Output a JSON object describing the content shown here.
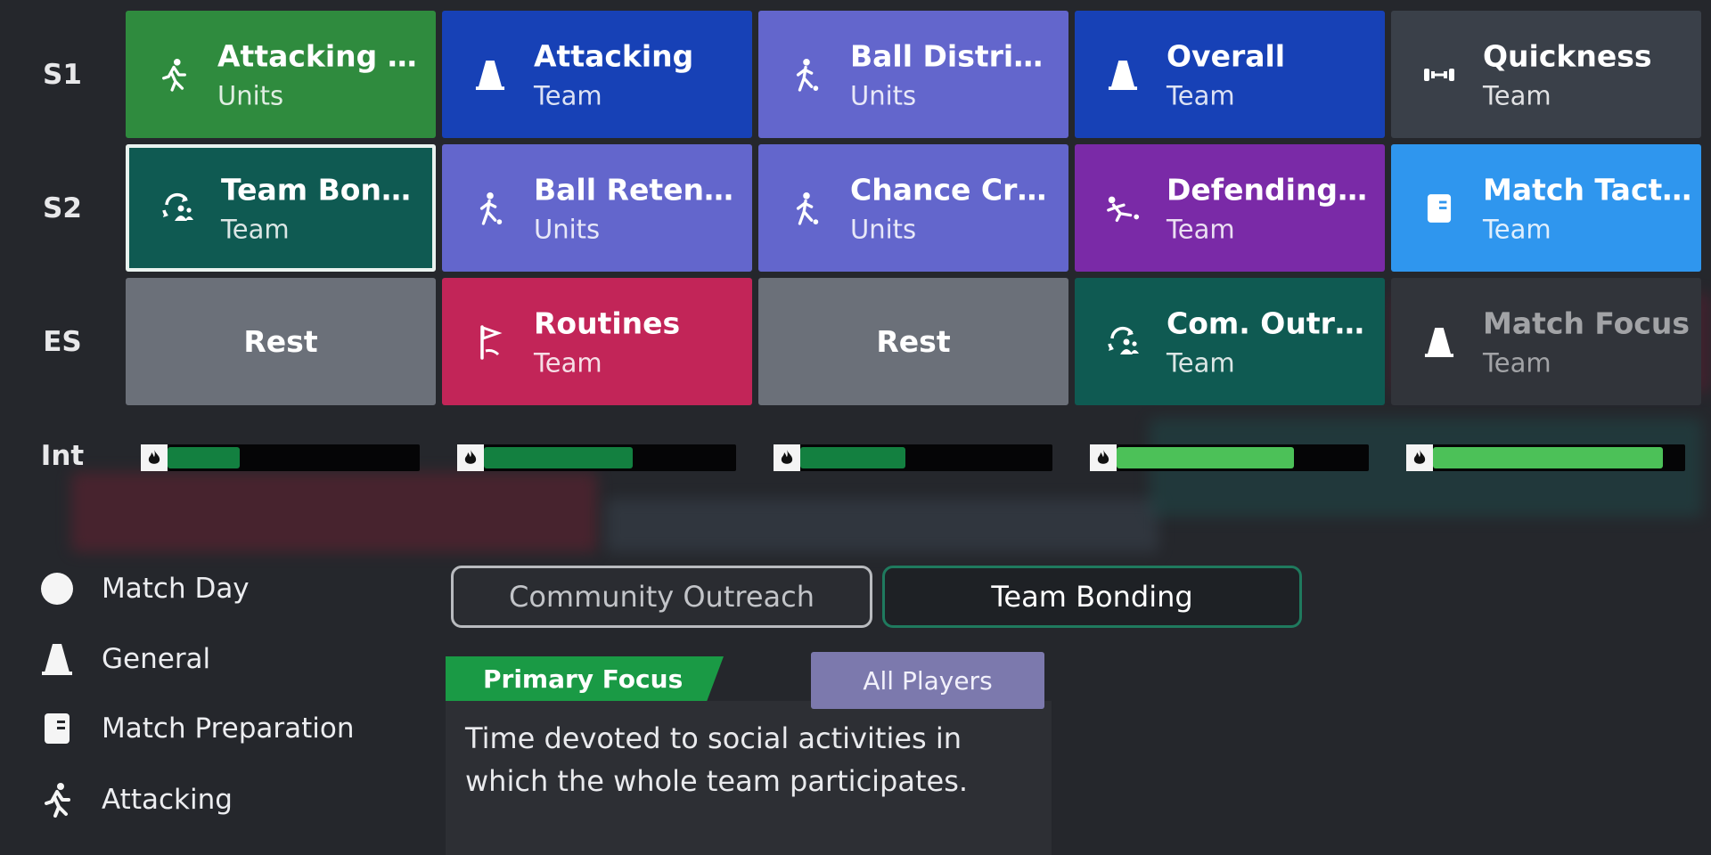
{
  "rows": [
    {
      "label": "S1",
      "cells": [
        {
          "title": "Attacking Direct",
          "sub": "Units",
          "icon": "running-person-icon",
          "color": "#2f8b3e"
        },
        {
          "title": "Attacking",
          "sub": "Team",
          "icon": "cone-icon",
          "color": "#1741b6"
        },
        {
          "title": "Ball Distribution",
          "sub": "Units",
          "icon": "kicking-person-icon",
          "color": "#6366cc"
        },
        {
          "title": "Overall",
          "sub": "Team",
          "icon": "cone-icon",
          "color": "#1741b6"
        },
        {
          "title": "Quickness",
          "sub": "Team",
          "icon": "dumbbell-icon",
          "color": "#3a4049"
        }
      ]
    },
    {
      "label": "S2",
      "cells": [
        {
          "title": "Team Bonding",
          "sub": "Team",
          "icon": "team-cycle-icon",
          "color": "#0f5a52",
          "selected": true
        },
        {
          "title": "Ball Retention",
          "sub": "Units",
          "icon": "kicking-person-icon",
          "color": "#6366cc"
        },
        {
          "title": "Chance Creation",
          "sub": "Units",
          "icon": "kicking-person-icon",
          "color": "#6366cc"
        },
        {
          "title": "Defending from the...",
          "sub": "Team",
          "icon": "tackle-icon",
          "color": "#7a2aa7"
        },
        {
          "title": "Match Tactics",
          "sub": "Team",
          "icon": "clipboard-icon",
          "color": "#2f96ee"
        }
      ]
    },
    {
      "label": "ES",
      "cells": [
        {
          "title": "Rest",
          "sub": "",
          "icon": "",
          "color": "#6b7079",
          "rest": true
        },
        {
          "title": "Routines",
          "sub": "Team",
          "icon": "corner-flag-icon",
          "color": "#c22558"
        },
        {
          "title": "Rest",
          "sub": "",
          "icon": "",
          "color": "#6b7079",
          "rest": true
        },
        {
          "title": "Com. Outreach",
          "sub": "Team",
          "icon": "team-cycle-icon",
          "color": "#0f5a52"
        },
        {
          "title": "Match Focus",
          "sub": "Team",
          "icon": "cone-icon",
          "color": "#31343a",
          "dim": true
        }
      ]
    }
  ],
  "intensity": {
    "label": "Int",
    "bars": [
      {
        "level": 0.15,
        "color": "#138040"
      },
      {
        "level": 0.31,
        "color": "#138040"
      },
      {
        "level": 0.22,
        "color": "#138040"
      },
      {
        "level": 0.37,
        "color": "#4cc158"
      },
      {
        "level": 0.48,
        "color": "#4cc158"
      }
    ]
  },
  "legend": [
    {
      "label": "Match Day",
      "icon": "circle-icon"
    },
    {
      "label": "General",
      "icon": "cone-icon"
    },
    {
      "label": "Match Preparation",
      "icon": "clipboard-icon"
    },
    {
      "label": "Attacking",
      "icon": "running-person-icon"
    }
  ],
  "tabs": [
    {
      "label": "Community Outreach",
      "active": false
    },
    {
      "label": "Team Bonding",
      "active": true
    }
  ],
  "detail": {
    "primary_tag": "Primary Focus",
    "players_tag": "All Players",
    "description": "Time devoted to social activities in which the whole team participates."
  },
  "colors": {
    "accent": "#1a9a45",
    "background": "#25272c"
  }
}
